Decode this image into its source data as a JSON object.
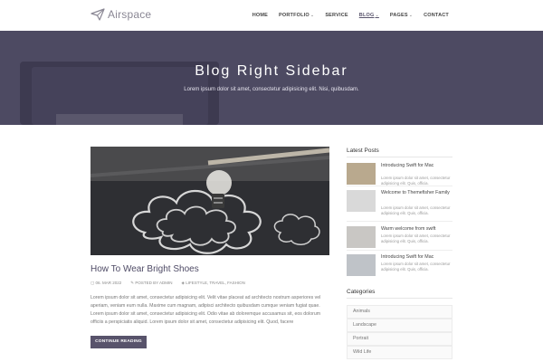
{
  "header": {
    "logo_text": "Airspace",
    "nav": [
      {
        "label": "HOME",
        "dropdown": false,
        "active": false
      },
      {
        "label": "PORTFOLIO",
        "dropdown": true,
        "active": false
      },
      {
        "label": "SERVICE",
        "dropdown": false,
        "active": false
      },
      {
        "label": "BLOG",
        "dropdown": true,
        "active": true
      },
      {
        "label": "PAGES",
        "dropdown": true,
        "active": false
      },
      {
        "label": "CONTACT",
        "dropdown": false,
        "active": false
      }
    ]
  },
  "hero": {
    "title": "Blog Right Sidebar",
    "subtitle": "Lorem ipsum dolor sit amet, consectetur adipisicing elit. Nisi, quibusdam."
  },
  "post": {
    "title": "How To Wear Bright Shoes",
    "date": "06. MAR 2022",
    "author": "POSTED BY ADMIN",
    "tags": "LIFESTYLE, TRAVEL, FASHION",
    "excerpt": "Lorem ipsum dolor sit amet, consectetur adipisicing elit. Velit vitae placeat ad architecto nostrum asperiores vel aperiam, veniam eum nulla. Maxime cum magnam, adipisci architecto quibusdam cumque veniam fugiat quae. Lorem ipsum dolor sit amet, consectetur adipisicing elit. Odio vitae ab doloremque accusamus sit, eos dolorum officiis a perspiciatis aliquid. Lorem ipsum dolor sit amet, consectetur adipisicing elit. Quod, facere",
    "button_label": "CONTINUE READING"
  },
  "sidebar": {
    "latest_heading": "Latest Posts",
    "latest_posts": [
      {
        "title": "Introducing Swift for Mac",
        "text": "Lorem ipsum dolor sit amet, consectetur adipisicing elit. Quis, officia.",
        "thumb_color": "#b9a98e"
      },
      {
        "title": "Welcome to Themefisher Family",
        "text": "Lorem ipsum dolor sit amet, consectetur adipisicing elit. Quis, officia.",
        "thumb_color": "#d9d9d9"
      },
      {
        "title": "Warm welcome from swift",
        "text": "Lorem ipsum dolor sit amet, consectetur adipisicing elit. Quis, officia.",
        "thumb_color": "#c9c7c4"
      },
      {
        "title": "Introducing Swift for Mac",
        "text": "Lorem ipsum dolor sit amet, consectetur adipisicing elit. Quis, officia.",
        "thumb_color": "#bfc3c8"
      }
    ],
    "categories_heading": "Categories",
    "categories": [
      "Animals",
      "Landscape",
      "Portrait",
      "Wild Life"
    ]
  }
}
